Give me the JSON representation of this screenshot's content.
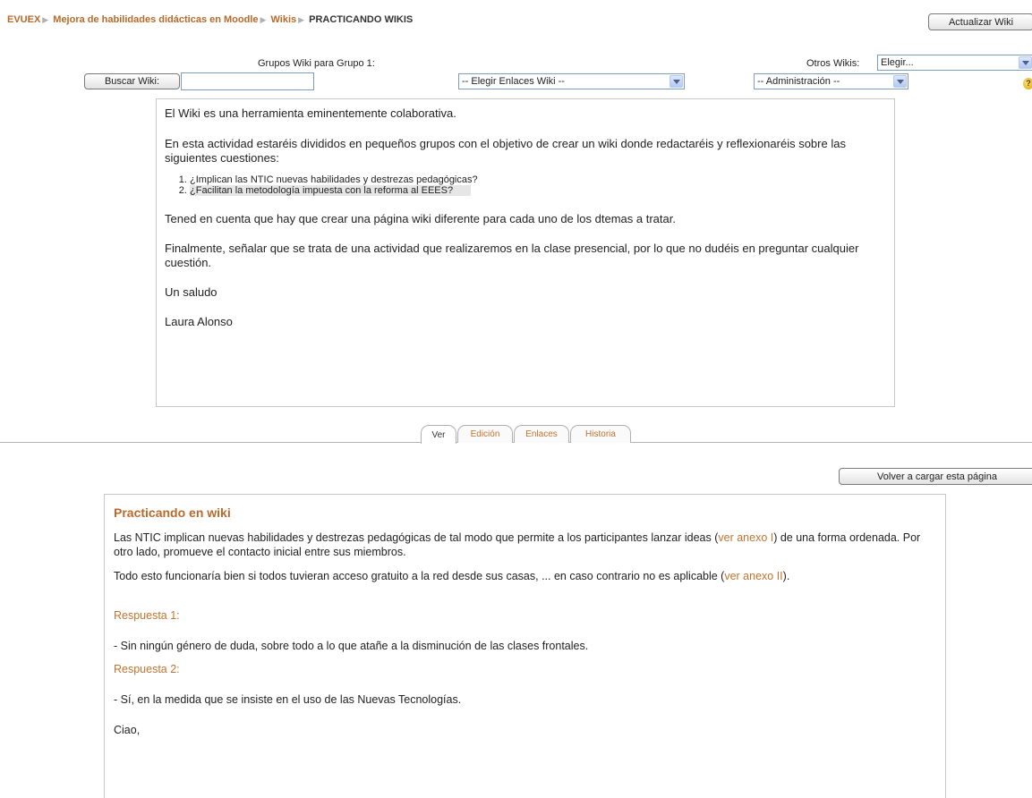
{
  "breadcrumb": {
    "items": [
      "EVUEX",
      "Mejora de habilidades didácticas en Moodle",
      "Wikis"
    ],
    "current": "PRACTICANDO WIKIS"
  },
  "header": {
    "update_wiki_button": "Actualizar Wiki",
    "groups_label": "Grupos Wiki para Grupo 1:",
    "other_wikis_label": "Otros Wikis:",
    "other_wikis_select": "Elegir...",
    "search_button": "Buscar Wiki:",
    "search_value": "",
    "links_select": "-- Elegir Enlaces Wiki --",
    "admin_select": "-- Administración --",
    "help_icon": "help-icon"
  },
  "content": {
    "p1": "El Wiki es una herramienta eminentemente colaborativa.",
    "p2": "En esta actividad estaréis divididos en pequeños grupos con el objetivo de crear un wiki donde redactaréis y reflexionaréis sobre las siguientes cuestiones:",
    "list": [
      "¿Implican las NTIC nuevas habilidades y destrezas pedagógicas?",
      "¿Facilitan la metodología impuesta con la reforma al EEES?"
    ],
    "p3": "Tened en cuenta que hay que crear una página wiki diferente para cada uno de los dtemas a tratar.",
    "p4": "Finalmente, señalar que se trata de una actividad que realizaremos en la clase presencial, por lo que no dudéis en preguntar cualquier cuestión.",
    "p5": "Un saludo",
    "p6": "Laura Alonso"
  },
  "tabs": [
    {
      "label": "Ver",
      "active": true
    },
    {
      "label": "Edición",
      "active": false
    },
    {
      "label": "Enlaces",
      "active": false
    },
    {
      "label": "Historia",
      "active": false
    }
  ],
  "reload_button": "Volver a cargar esta página",
  "wiki_page": {
    "title": "Practicando en wiki",
    "p1_a": "Las NTIC implican nuevas habilidades y destrezas pedagógicas de tal modo que permite a los participantes lanzar ideas (",
    "p1_link": "ver anexo I",
    "p1_b": ") de una forma ordenada. Por otro lado, promueve el contacto inicial entre sus miembros.",
    "p2_a": "Todo esto funcionaría bien si todos tuvieran acceso gratuito a la red desde sus casas, ... en caso contrario no es aplicable (",
    "p2_link": "ver anexo II",
    "p2_b": ").",
    "answer1_label": "Respuesta 1:",
    "answer1_text": "- Sin ningún género de duda, sobre todo a lo que atañe a la disminución de las clases frontales.",
    "answer2_label": "Respuesta 2:",
    "answer2_text": "- Sí, en la medida que se insiste en el uso de las Nuevas Tecnologías.",
    "closing": "Ciao,"
  }
}
